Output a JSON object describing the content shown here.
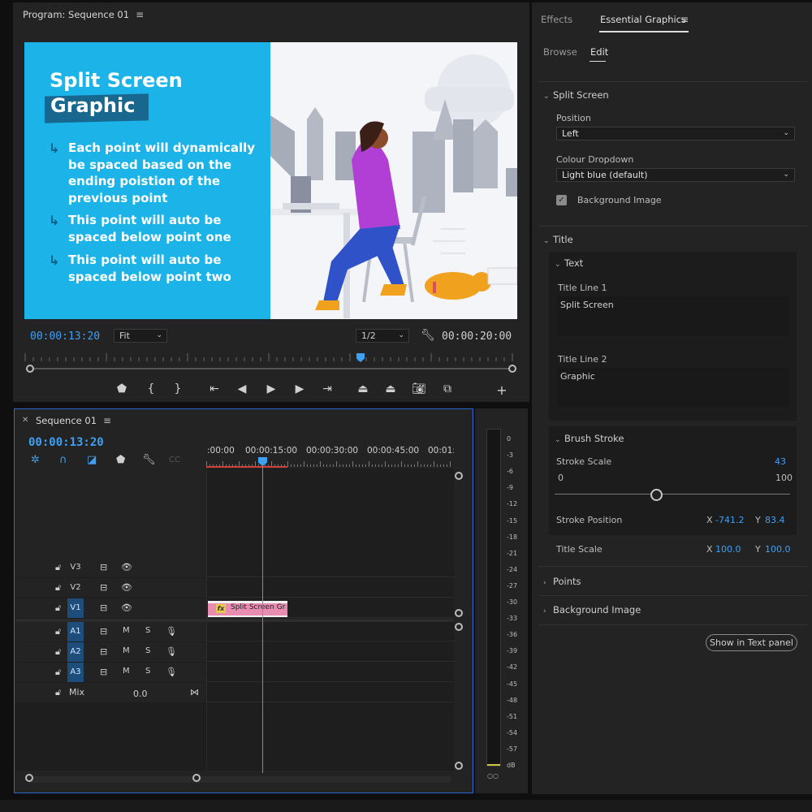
{
  "program": {
    "title": "Program: Sequence 01",
    "timecode_current": "00:00:13:20",
    "timecode_duration": "00:00:20:00",
    "fit_label": "Fit",
    "resolution_label": "1/2",
    "video": {
      "title_line1": "Split Screen",
      "title_line2": "Graphic",
      "points": [
        "Each point will dynamically be spaced based on the ending poistion of the previous point",
        "This point will auto be spaced below point one",
        "This point will auto be spaced below point two"
      ],
      "left_color": "#1bb3e8",
      "brush_color": "#17678f"
    }
  },
  "essential_graphics": {
    "tabs": [
      "Effects",
      "Essential Graphics"
    ],
    "subtabs": [
      "Browse",
      "Edit"
    ],
    "split_screen": {
      "header": "Split Screen",
      "position_label": "Position",
      "position_value": "Left",
      "colour_label": "Colour Dropdown",
      "colour_value": "Light blue (default)",
      "background_image_label": "Background Image",
      "background_image_checked": true
    },
    "title": {
      "header": "Title",
      "text_header": "Text",
      "line1_label": "Title Line 1",
      "line1_value": "Split Screen",
      "line2_label": "Title Line 2",
      "line2_value": "Graphic",
      "brush_header": "Brush Stroke",
      "stroke_scale_label": "Stroke Scale",
      "stroke_scale_value": "43",
      "stroke_scale_min": "0",
      "stroke_scale_max": "100",
      "stroke_scale_fraction": 0.43,
      "stroke_position_label": "Stroke Position",
      "stroke_position_x": "-741.2",
      "stroke_position_y": "83.4",
      "title_scale_label": "Title Scale",
      "title_scale_x": "100.0",
      "title_scale_y": "100.0",
      "x_label": "X",
      "y_label": "Y"
    },
    "points_header": "Points",
    "background_image_header": "Background Image",
    "show_text_panel_button": "Show in Text panel"
  },
  "timeline": {
    "title": "Sequence 01",
    "timecode": "00:00:13:20",
    "ruler_labels": [
      ":00:00",
      "00:00:15:00",
      "00:00:30:00",
      "00:00:45:00",
      "00:01:("
    ],
    "video_tracks": [
      "V3",
      "V2",
      "V1"
    ],
    "audio_tracks": [
      "A1",
      "A2",
      "A3"
    ],
    "mute_label": "M",
    "solo_label": "S",
    "mix_label": "Mix",
    "mix_value": "0.0",
    "clip_label": "Split Screen Gra",
    "clip_fx": "fx"
  },
  "meter": {
    "labels": [
      "0",
      "-3",
      "-6",
      "-9",
      "-12",
      "-15",
      "-18",
      "-21",
      "-24",
      "-27",
      "-30",
      "-33",
      "-36",
      "-39",
      "-42",
      "-45",
      "-48",
      "-51",
      "-54",
      "-57",
      "dB"
    ]
  }
}
